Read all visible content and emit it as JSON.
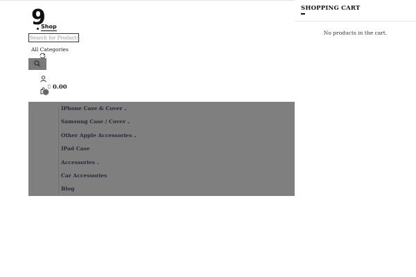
{
  "logo": {
    "number": "9",
    "text": "Shop"
  },
  "search": {
    "placeholder": "Search for Products",
    "category": "All Categories"
  },
  "cart": {
    "total": "0.00"
  },
  "nav": {
    "items": [
      {
        "label": "IPhone Case & Cover",
        "caret": "⌄"
      },
      {
        "label": "Samsung Case / Cover",
        "caret": "⌄"
      },
      {
        "label": "Other Apple Accessories",
        "caret": "⌄"
      },
      {
        "label": "IPad Case"
      },
      {
        "label": "Accessories",
        "caret": "⌄"
      },
      {
        "label": "Car Accessories"
      },
      {
        "label": "Blog"
      }
    ]
  },
  "cart_panel": {
    "title": "SHOPPING CART",
    "empty_message": "No products in the cart."
  },
  "icons": {
    "search": "search-icon",
    "compare": "compare-icon",
    "user": "user-icon",
    "cart": "shopping-bag-icon"
  },
  "colors": {
    "overlay": "#7f7f7f",
    "search_button": "#7a7a7a",
    "nav_text": "#2a2a3a"
  }
}
